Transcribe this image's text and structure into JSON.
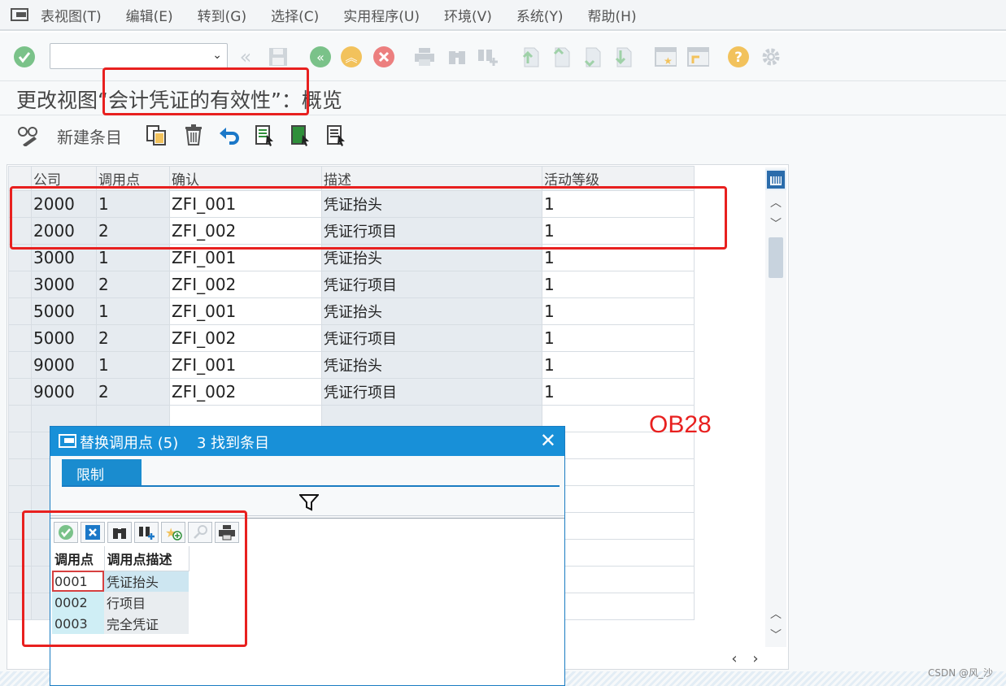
{
  "menu": {
    "items": [
      "表视图(T)",
      "编辑(E)",
      "转到(G)",
      "选择(C)",
      "实用程序(U)",
      "环境(V)",
      "系统(Y)",
      "帮助(H)"
    ]
  },
  "toolbar": {
    "command_value": "",
    "icons": [
      "ok-icon",
      "dropdown-icon",
      "back-double-icon",
      "save-icon",
      "back-icon",
      "exit-icon",
      "cancel-icon",
      "print-icon",
      "find-icon",
      "find-next-icon",
      "first-page-icon",
      "prev-page-icon",
      "next-page-icon",
      "last-page-icon",
      "create-session-icon",
      "shortcut-icon",
      "help-icon",
      "settings-icon"
    ]
  },
  "title": "更改视图“会计凭证的有效性”：概览",
  "apptoolbar": {
    "new_entry": "新建条目"
  },
  "grid": {
    "headers": [
      "公司",
      "调用点",
      "确认",
      "描述",
      "活动等级"
    ],
    "rows": [
      [
        "2000",
        "1",
        "ZFI_001",
        "凭证抬头",
        "1"
      ],
      [
        "2000",
        "2",
        "ZFI_002",
        "凭证行项目",
        "1"
      ],
      [
        "3000",
        "1",
        "ZFI_001",
        "凭证抬头",
        "1"
      ],
      [
        "3000",
        "2",
        "ZFI_002",
        "凭证行项目",
        "1"
      ],
      [
        "5000",
        "1",
        "ZFI_001",
        "凭证抬头",
        "1"
      ],
      [
        "5000",
        "2",
        "ZFI_002",
        "凭证行项目",
        "1"
      ],
      [
        "9000",
        "1",
        "ZFI_001",
        "凭证抬头",
        "1"
      ],
      [
        "9000",
        "2",
        "ZFI_002",
        "凭证行项目",
        "1"
      ]
    ]
  },
  "popup": {
    "title": "替换调用点 (5)",
    "count": "3 找到条目",
    "tab": "限制",
    "headers": [
      "调用点",
      "调用点描述"
    ],
    "rows": [
      [
        "0001",
        "凭证抬头"
      ],
      [
        "0002",
        "行项目"
      ],
      [
        "0003",
        "完全凭证"
      ]
    ]
  },
  "annotation": "OB28",
  "watermark": "CSDN @风_沙",
  "colors": {
    "accent": "#1890d8",
    "annotation_red": "#e8201f"
  }
}
